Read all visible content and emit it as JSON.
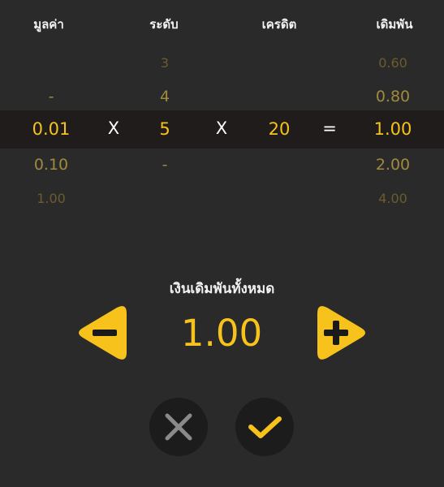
{
  "headers": {
    "value": "มูลค่า",
    "level": "ระดับ",
    "credit": "เครดิต",
    "bet": "เดิมพัน"
  },
  "value_column": {
    "above_near": "-",
    "selected": "0.01",
    "below_near": "0.10",
    "below_far": "1.00"
  },
  "level_column": {
    "above_far": "3",
    "above_near": "4",
    "selected": "5",
    "below_near": "-"
  },
  "credit_column": {
    "selected": "20"
  },
  "bet_column": {
    "above_far": "0.60",
    "above_near": "0.80",
    "selected": "1.00",
    "below_near": "2.00",
    "below_far": "4.00"
  },
  "operators": {
    "multiply_1": "X",
    "multiply_2": "X",
    "equals": "="
  },
  "total": {
    "label": "เงินเดิมพันทั้งหมด",
    "value": "1.00"
  },
  "icons": {
    "decrease": "minus-arrow-left-icon",
    "increase": "plus-arrow-right-icon",
    "cancel": "close-icon",
    "confirm": "check-icon"
  },
  "colors": {
    "background": "#2a2a2a",
    "selected_band": "#211c1c",
    "accent": "#f7c21b",
    "button_bg": "#1c1c1c"
  }
}
